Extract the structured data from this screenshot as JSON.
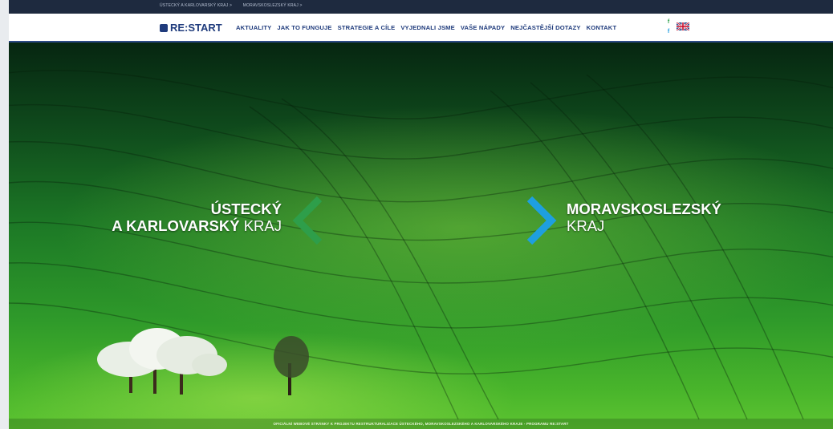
{
  "topbar": {
    "crumbs": [
      "ÚSTECKÝ A KARLOVARSKÝ KRAJ >",
      "MORAVSKOSLEZSKÝ KRAJ >"
    ]
  },
  "logo": {
    "text": "RE:START"
  },
  "menu": [
    "AKTUALITY",
    "JAK TO FUNGUJE",
    "STRATEGIE A CÍLE",
    "VYJEDNALI JSME",
    "VAŠE NÁPADY",
    "NEJČASTĚJŠÍ DOTAZY",
    "KONTAKT"
  ],
  "social": {
    "icon": "facebook-icon",
    "glyph": "f"
  },
  "language_flag": {
    "icon": "uk-flag-icon"
  },
  "regions": {
    "left": {
      "line1": "ÚSTECKÝ",
      "line2_bold": "A KARLOVARSKÝ",
      "line2_rest": " KRAJ",
      "arrow_color": "#2e9e4a"
    },
    "right": {
      "line1": "MORAVSKOSLEZSKÝ",
      "line2": "KRAJ",
      "arrow_color": "#1e9fe0"
    }
  },
  "footer": {
    "text": "OFICIÁLNÍ WEBOVÉ STRÁNKY K PROJEKTU RESTRUKTURALIZACE ÚSTECKÉHO, MORAVSKOSLEZSKÉHO A KARLOVARSKÉHO KRAJE - PROGRAMU RE:START"
  }
}
